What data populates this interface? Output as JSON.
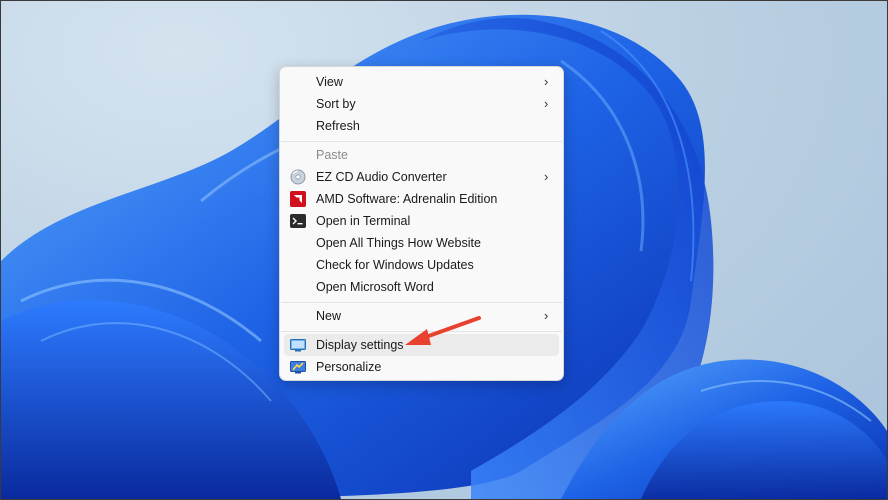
{
  "context_menu": {
    "group1": [
      {
        "label": "View",
        "submenu": true
      },
      {
        "label": "Sort by",
        "submenu": true
      },
      {
        "label": "Refresh",
        "submenu": false
      }
    ],
    "group2": [
      {
        "label": "Paste",
        "disabled": true
      },
      {
        "label": "EZ CD Audio Converter",
        "icon": "cd-icon",
        "submenu": true
      },
      {
        "label": "AMD Software: Adrenalin Edition",
        "icon": "amd-icon"
      },
      {
        "label": "Open in Terminal",
        "icon": "terminal-icon"
      },
      {
        "label": "Open All Things How Website"
      },
      {
        "label": "Check for Windows Updates"
      },
      {
        "label": "Open Microsoft Word"
      }
    ],
    "group3": [
      {
        "label": "New",
        "submenu": true
      }
    ],
    "group4": [
      {
        "label": "Display settings",
        "icon": "display-icon",
        "highlighted": true
      },
      {
        "label": "Personalize",
        "icon": "personalize-icon"
      }
    ],
    "chevron": "›"
  },
  "colors": {
    "wallpaper_blue": "#1e63e6",
    "annotation_arrow": "#e8412f",
    "menu_bg": "#f9f9f9"
  }
}
